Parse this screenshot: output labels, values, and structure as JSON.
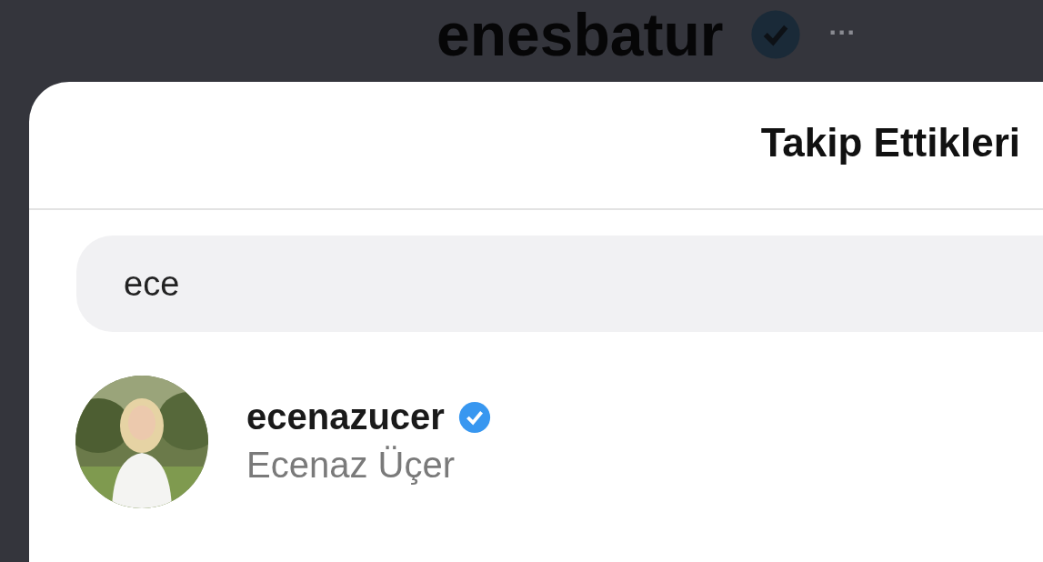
{
  "background_profile": {
    "username": "enesbatur",
    "verified": true,
    "more": "···"
  },
  "modal": {
    "title": "Takip Ettikleri",
    "search": {
      "value": "ece"
    },
    "results": [
      {
        "username": "ecenazucer",
        "verified": true,
        "full_name": "Ecenaz Üçer"
      }
    ]
  }
}
